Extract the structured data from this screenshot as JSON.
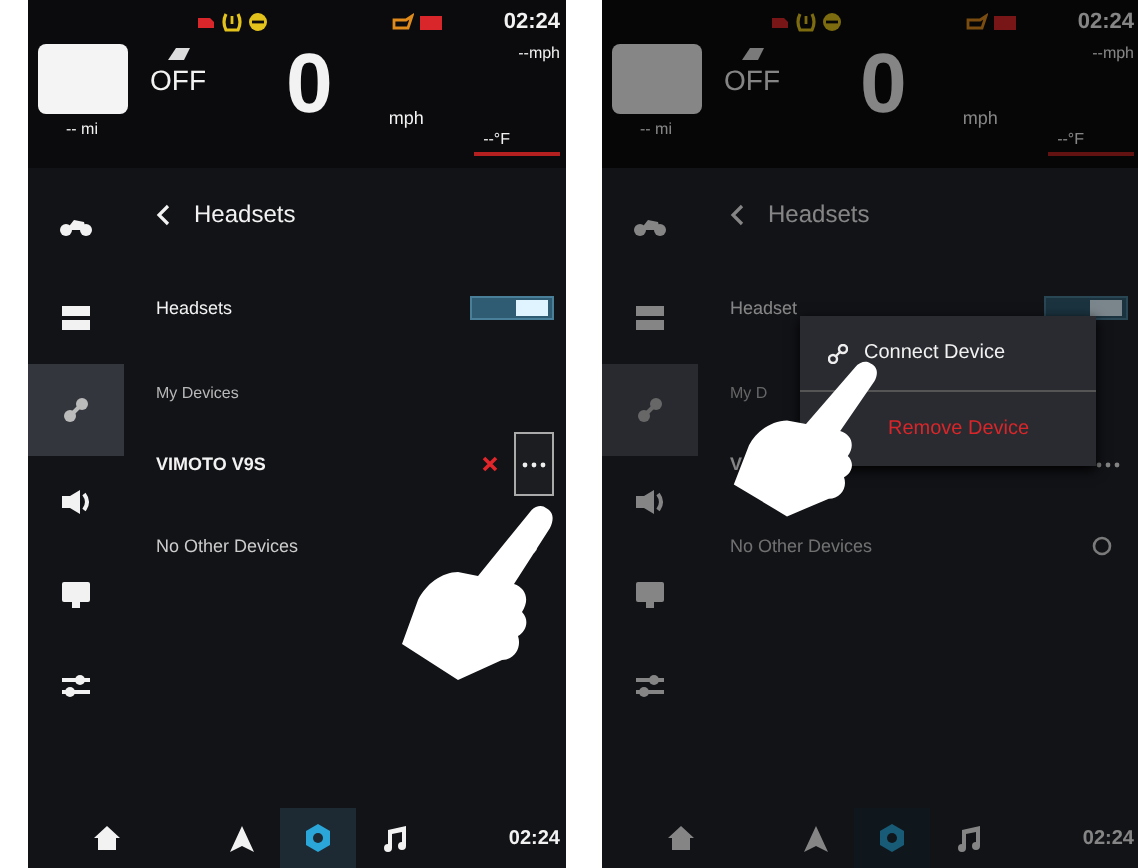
{
  "screens": [
    {
      "dimmed": false,
      "hand_shown": true,
      "status": {
        "time": "02:24",
        "odometer": "-- mi",
        "engine_state": "OFF",
        "speed": "0",
        "speed_unit": "mph",
        "avg_speed": "--mph",
        "temperature": "--°F"
      },
      "sidebar": [
        {
          "selected": false
        },
        {
          "selected": false
        },
        {
          "selected": true
        },
        {
          "selected": false
        },
        {
          "selected": false
        },
        {
          "selected": false
        }
      ],
      "page_title": "Headsets",
      "toggle": {
        "label": "Headsets",
        "on": true
      },
      "section": "My Devices",
      "device": {
        "name": "VIMOTO V9S",
        "removable": true,
        "focused": true
      },
      "other": "No Other Devices",
      "nav": [
        {
          "selected": false
        },
        {
          "selected": false
        },
        {
          "selected": true
        },
        {
          "selected": false
        }
      ],
      "clock": "02:24"
    },
    {
      "dimmed": true,
      "hand_shown": true,
      "status": {
        "time": "02:24",
        "odometer": "-- mi",
        "engine_state": "OFF",
        "speed": "0",
        "speed_unit": "mph",
        "avg_speed": "--mph",
        "temperature": "--°F"
      },
      "sidebar": [
        {
          "selected": false
        },
        {
          "selected": false
        },
        {
          "selected": true
        },
        {
          "selected": false
        },
        {
          "selected": false
        },
        {
          "selected": false
        }
      ],
      "page_title": "Headsets",
      "toggle": {
        "label": "Headset",
        "on": true
      },
      "section": "My D",
      "device": {
        "name": "V",
        "removable": false,
        "focused": false
      },
      "other": "No Other Devices",
      "nav": [
        {
          "selected": false
        },
        {
          "selected": false
        },
        {
          "selected": true
        },
        {
          "selected": false
        }
      ],
      "clock": "02:24",
      "menu": {
        "items": [
          {
            "label": "Connect Device",
            "kind": "connect"
          },
          {
            "label": "Remove Device",
            "kind": "remove"
          }
        ]
      }
    }
  ]
}
